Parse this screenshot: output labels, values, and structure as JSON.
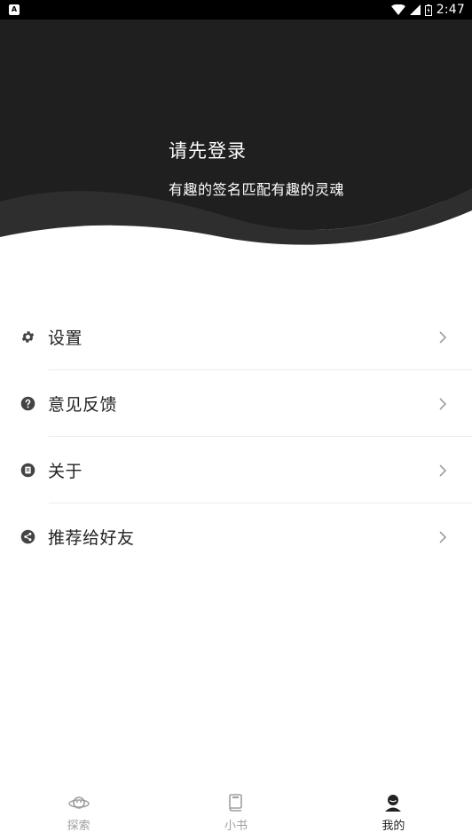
{
  "status_bar": {
    "time": "2:47",
    "notification_icon": "app-notification-icon",
    "icons": [
      "wifi-icon",
      "cell-signal-icon",
      "battery-icon"
    ]
  },
  "header": {
    "title": "请先登录",
    "subtitle": "有趣的签名匹配有趣的灵魂",
    "background_color": "#1f1f1f",
    "wave_color": "#2e2e2e"
  },
  "menu": {
    "items": [
      {
        "label": "设置",
        "icon": "gear-icon"
      },
      {
        "label": "意见反馈",
        "icon": "question-icon"
      },
      {
        "label": "关于",
        "icon": "info-card-icon"
      },
      {
        "label": "推荐给好友",
        "icon": "share-icon"
      }
    ]
  },
  "bottom_nav": {
    "items": [
      {
        "label": "探索",
        "icon": "planet-icon",
        "active": false
      },
      {
        "label": "小书",
        "icon": "book-icon",
        "active": false
      },
      {
        "label": "我的",
        "icon": "user-icon",
        "active": true
      }
    ]
  },
  "colors": {
    "icon_dark": "#444444",
    "inactive": "#9e9e9e",
    "active": "#222222",
    "divider": "#ececec"
  }
}
